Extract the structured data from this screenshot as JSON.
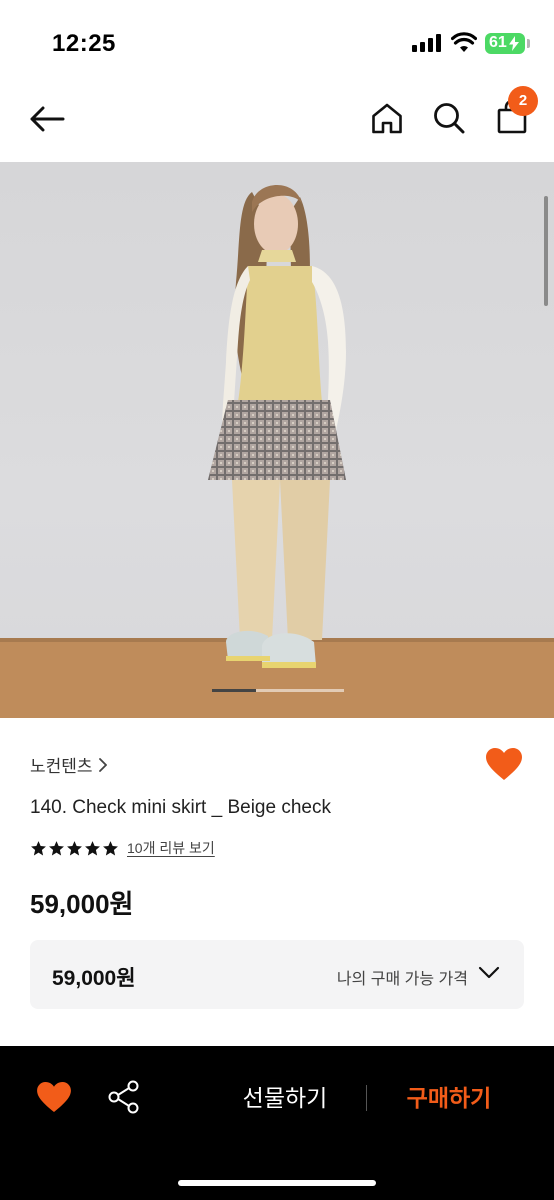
{
  "status_bar": {
    "time": "12:25",
    "battery": "61",
    "icons": [
      "signal-icon",
      "wifi-icon",
      "battery-icon"
    ]
  },
  "nav": {
    "icons": [
      "back-arrow-icon",
      "home-icon",
      "search-icon",
      "shopping-bag-icon"
    ],
    "cart_count": "2"
  },
  "product": {
    "image_alt": "product-photo",
    "brand": "노컨텐츠",
    "title": "140. Check mini skirt _ Beige check",
    "rating_stars": 5,
    "review_link": "10개 리뷰 보기",
    "price": "59,000원"
  },
  "price_box": {
    "value": "59,000원",
    "label": "나의 구매 가능 가격"
  },
  "bottom_bar": {
    "gift_label": "선물하기",
    "buy_label": "구매하기",
    "icons": [
      "heart-icon",
      "share-icon"
    ]
  },
  "colors": {
    "accent": "#f25c19",
    "bottom_bar_bg": "#000000",
    "price_box_bg": "#f4f4f5"
  }
}
